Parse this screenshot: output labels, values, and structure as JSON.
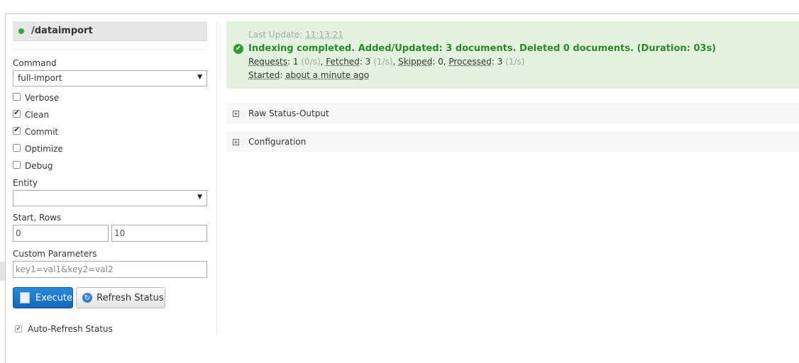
{
  "handler": {
    "name": "/dataimport",
    "status_color": "#3aa53a"
  },
  "form": {
    "command_label": "Command",
    "command_value": "full-import",
    "options": [
      {
        "label": "Verbose",
        "checked": false
      },
      {
        "label": "Clean",
        "checked": true
      },
      {
        "label": "Commit",
        "checked": true
      },
      {
        "label": "Optimize",
        "checked": false
      },
      {
        "label": "Debug",
        "checked": false
      }
    ],
    "entity_label": "Entity",
    "entity_value": "",
    "start_rows_label": "Start, Rows",
    "start_value": "0",
    "rows_value": "10",
    "custom_params_label": "Custom Parameters",
    "custom_params_placeholder": "key1=val1&key2=val2",
    "execute_label": "Execute",
    "refresh_label": "Refresh Status",
    "auto_refresh_label": "Auto-Refresh Status",
    "auto_refresh_checked": true
  },
  "status": {
    "last_update_label": "Last Update:",
    "last_update_value": "11:13:21",
    "message": "Indexing completed. Added/Updated: 3 documents. Deleted 0 documents. (Duration: 03s)",
    "requests_label": "Requests",
    "requests_value": "1",
    "requests_rate": "(0/s)",
    "fetched_label": "Fetched",
    "fetched_value": "3",
    "fetched_rate": "(1/s)",
    "skipped_label": "Skipped",
    "skipped_value": "0",
    "processed_label": "Processed",
    "processed_value": "3",
    "processed_rate": "(1/s)",
    "started_label": "Started",
    "started_value": "about a minute ago",
    "colors": {
      "success_bg": "#e3f1df",
      "success_text": "#2b8a2b"
    }
  },
  "sections": {
    "raw_output": "Raw Status-Output",
    "configuration": "Configuration"
  },
  "glyphs": {
    "check": "✔",
    "plus": "+",
    "arrow": "▼"
  }
}
